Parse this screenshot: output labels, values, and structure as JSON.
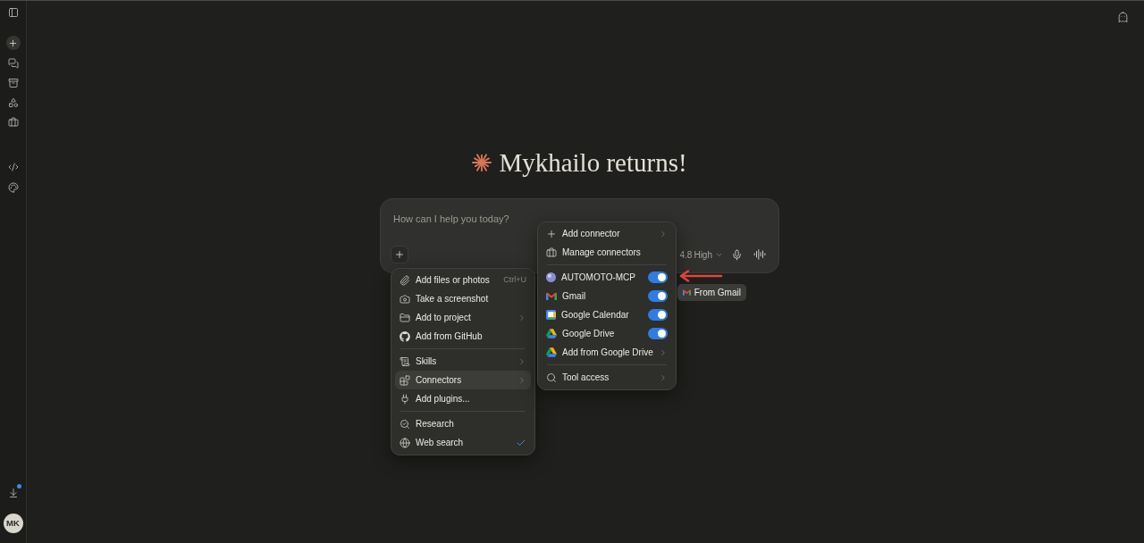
{
  "sidebar": {
    "download_notification": true,
    "avatar_initials": "MK"
  },
  "greeting": "Mykhailo returns!",
  "composer": {
    "placeholder": "How can I help you today?",
    "model": "4.8",
    "effort": "High"
  },
  "attach_menu": {
    "sections": [
      {
        "items": [
          {
            "kind": "action",
            "label": "Add files or photos",
            "shortcut": "Ctrl+U",
            "selected": false
          },
          {
            "kind": "action",
            "label": "Take a screenshot",
            "selected": false
          },
          {
            "kind": "submenu",
            "label": "Add to project",
            "selected": false
          },
          {
            "kind": "action",
            "label": "Add from GitHub",
            "selected": false
          }
        ]
      },
      {
        "items": [
          {
            "kind": "submenu",
            "label": "Skills",
            "selected": false
          },
          {
            "kind": "submenu",
            "label": "Connectors",
            "selected": true
          },
          {
            "kind": "action",
            "label": "Add plugins...",
            "selected": false
          }
        ]
      },
      {
        "items": [
          {
            "kind": "toggle",
            "label": "Research",
            "selected": false,
            "checked": false
          },
          {
            "kind": "toggle",
            "label": "Web search",
            "selected": false,
            "checked": true
          }
        ]
      }
    ]
  },
  "connectors_menu": {
    "sections": [
      {
        "items": [
          {
            "kind": "submenu",
            "label": "Add connector"
          },
          {
            "kind": "action",
            "label": "Manage connectors"
          }
        ]
      },
      {
        "items": [
          {
            "kind": "switch",
            "label": "AUTOMOTO-MCP",
            "on": true
          },
          {
            "kind": "switch",
            "label": "Gmail",
            "on": true
          },
          {
            "kind": "switch",
            "label": "Google Calendar",
            "on": true
          },
          {
            "kind": "switch",
            "label": "Google Drive",
            "on": true
          },
          {
            "kind": "submenu",
            "label": "Add from Google Drive"
          }
        ]
      },
      {
        "items": [
          {
            "kind": "submenu",
            "label": "Tool access"
          }
        ]
      }
    ]
  },
  "tooltip": {
    "text": "From Gmail"
  }
}
